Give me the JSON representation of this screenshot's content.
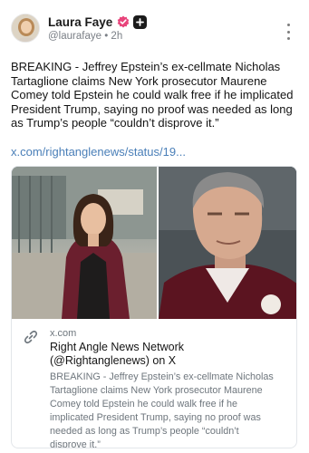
{
  "post": {
    "author": {
      "display_name": "Laura Faye",
      "handle": "@laurafaye",
      "separator": "•",
      "time": "2h",
      "verified_icon": "verified-badge-icon",
      "plus_icon": "plus-badge-icon"
    },
    "more_icon": "more-vertical-icon",
    "text": "BREAKING - Jeffrey Epstein’s ex-cellmate Nicholas Tartaglione claims New York prosecutor Maurene Comey told Epstein he could walk free if he implicated President Trump, saying no proof was needed as long as Trump’s people “couldn’t disprove it.”",
    "link_text": "x.com/rightanglenews/status/19...",
    "colors": {
      "link": "#4a7fb8",
      "verified_badge": "#e8447b",
      "plus_badge": "#1b1b1b"
    }
  },
  "card": {
    "link_icon": "link-icon",
    "domain": "x.com",
    "title": "Right Angle News Network (@Rightanglenews) on X",
    "description": "BREAKING - Jeffrey Epstein’s ex-cellmate Nicholas Tartaglione claims New York prosecutor Maurene Comey told Epstein he could walk free if he implicated President Trump, saying no proof was needed as long as Trump’s people “couldn’t disprove it.”"
  }
}
